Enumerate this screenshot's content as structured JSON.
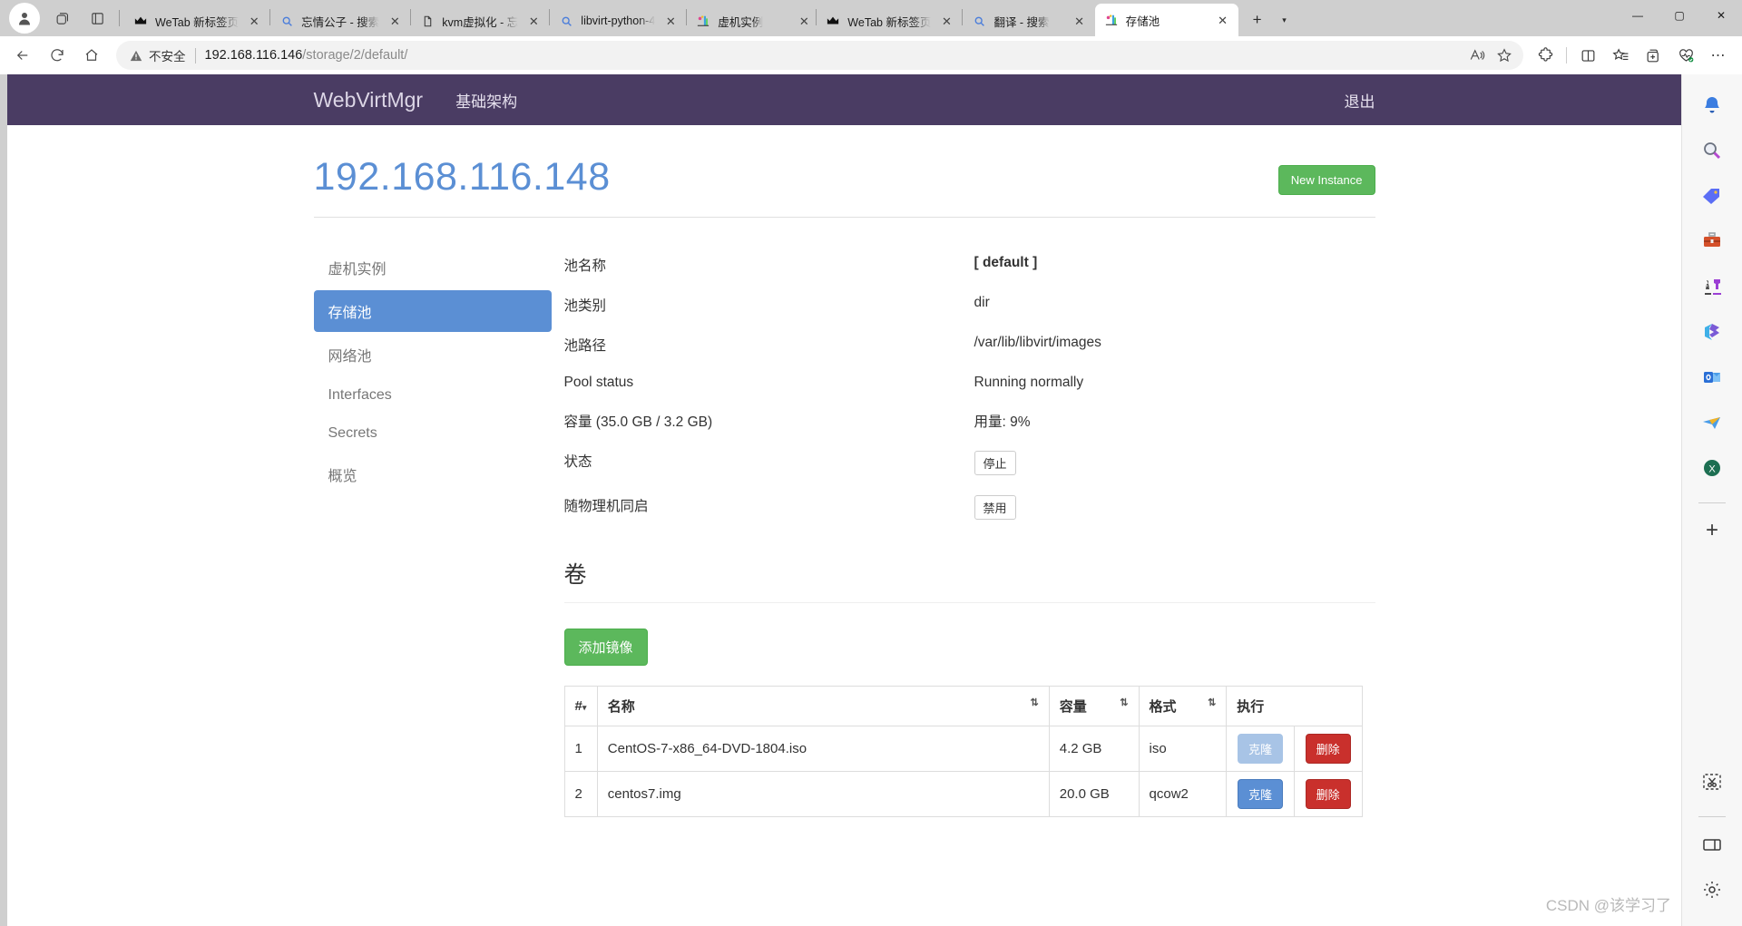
{
  "browser": {
    "profile_icon": "account-avatar-icon",
    "workspaces_icon": "workspaces-icon",
    "tab_actions_icon": "tab-actions-icon",
    "tabs": [
      {
        "title": "WeTab 新标签页",
        "favicon": "wetab-crown-icon",
        "active": false
      },
      {
        "title": "忘情公子 - 搜索",
        "favicon": "bing-search-icon",
        "active": false
      },
      {
        "title": "kvm虚拟化 - 忘",
        "favicon": "document-icon",
        "active": false
      },
      {
        "title": "libvirt-python-4",
        "favicon": "bing-search-icon",
        "active": false
      },
      {
        "title": "虚机实例",
        "favicon": "webvirtmgr-icon",
        "active": false
      },
      {
        "title": "WeTab 新标签页",
        "favicon": "wetab-crown-icon",
        "active": false
      },
      {
        "title": "翻译 - 搜索",
        "favicon": "bing-search-icon",
        "active": false
      },
      {
        "title": "存储池",
        "favicon": "webvirtmgr-icon",
        "active": true
      }
    ],
    "close_label": "✕",
    "new_tab_label": "+",
    "tab_menu_label": "▾",
    "window_controls": {
      "minimize": "—",
      "maximize": "▢",
      "close": "✕"
    },
    "nav": {
      "back_icon": "back-arrow-icon",
      "refresh_icon": "reload-icon",
      "home_icon": "home-icon"
    },
    "omnibox": {
      "security_label": "不安全",
      "security_icon": "warning-triangle-icon",
      "url_host": "192.168.116.146",
      "url_path": "/storage/2/default/",
      "read_aloud_icon": "read-aloud-icon",
      "favorite_icon": "star-outline-icon"
    },
    "toolbar": {
      "extensions_icon": "extensions-puzzle-icon",
      "split_screen_icon": "split-screen-icon",
      "favorites_icon": "favorites-list-icon",
      "collections_icon": "collections-add-icon",
      "performance_icon": "browser-essentials-heart-icon",
      "settings_more_label": "⋯"
    },
    "edge_sidebar": [
      {
        "icon": "notifications-bell-icon"
      },
      {
        "icon": "search-magnifier-icon"
      },
      {
        "icon": "shopping-tag-icon"
      },
      {
        "icon": "tools-toolbox-icon"
      },
      {
        "icon": "games-chess-icon"
      },
      {
        "icon": "microsoft-365-icon"
      },
      {
        "icon": "outlook-icon"
      },
      {
        "icon": "telegram-plane-icon"
      },
      {
        "icon": "excel-x-icon"
      }
    ],
    "edge_sidebar_add": "+",
    "edge_sidebar_bottom": [
      {
        "icon": "screenshot-scissors-icon"
      },
      {
        "icon": "sidebar-panel-icon"
      },
      {
        "icon": "gear-settings-icon"
      }
    ]
  },
  "app": {
    "brand": "WebVirtMgr",
    "nav_link": "基础架构",
    "logout": "退出",
    "page_title": "192.168.116.148",
    "new_instance_button": "New Instance",
    "accent_color": "#5b8fd4",
    "navbar_color": "#4a3c63",
    "success_color": "#5cb85c",
    "danger_color": "#c9302c",
    "sidebar": {
      "items": [
        {
          "label": "虚机实例",
          "active": false
        },
        {
          "label": "存储池",
          "active": true
        },
        {
          "label": "网络池",
          "active": false
        },
        {
          "label": "Interfaces",
          "active": false
        },
        {
          "label": "Secrets",
          "active": false
        },
        {
          "label": "概览",
          "active": false
        }
      ]
    },
    "pool_details": [
      {
        "key": "池名称",
        "value": "[ default ]",
        "bold": true,
        "type": "text"
      },
      {
        "key": "池类别",
        "value": "dir",
        "type": "text"
      },
      {
        "key": "池路径",
        "value": "/var/lib/libvirt/images",
        "type": "text"
      },
      {
        "key": "Pool status",
        "value": "Running normally",
        "type": "text"
      },
      {
        "key": "容量 (35.0 GB / 3.2 GB)",
        "value": "用量: 9%",
        "type": "text"
      },
      {
        "key": "状态",
        "value": "停止",
        "type": "button"
      },
      {
        "key": "随物理机同启",
        "value": "禁用",
        "type": "button"
      }
    ],
    "volumes": {
      "heading": "卷",
      "add_image_button": "添加镜像",
      "columns": [
        {
          "label": "#",
          "sortable": true,
          "sort_glyph": "▾"
        },
        {
          "label": "名称",
          "sortable": true,
          "sort_glyph": "⇅"
        },
        {
          "label": "容量",
          "sortable": true,
          "sort_glyph": "⇅"
        },
        {
          "label": "格式",
          "sortable": true,
          "sort_glyph": "⇅"
        },
        {
          "label": "执行",
          "sortable": false,
          "sort_glyph": ""
        }
      ],
      "rows": [
        {
          "index": "1",
          "name": "CentOS-7-x86_64-DVD-1804.iso",
          "size": "4.2 GB",
          "format": "iso",
          "clone_label": "克隆",
          "delete_label": "删除",
          "clone_muted": true
        },
        {
          "index": "2",
          "name": "centos7.img",
          "size": "20.0 GB",
          "format": "qcow2",
          "clone_label": "克隆",
          "delete_label": "删除",
          "clone_muted": false
        }
      ]
    }
  },
  "watermark": "CSDN @该学习了"
}
